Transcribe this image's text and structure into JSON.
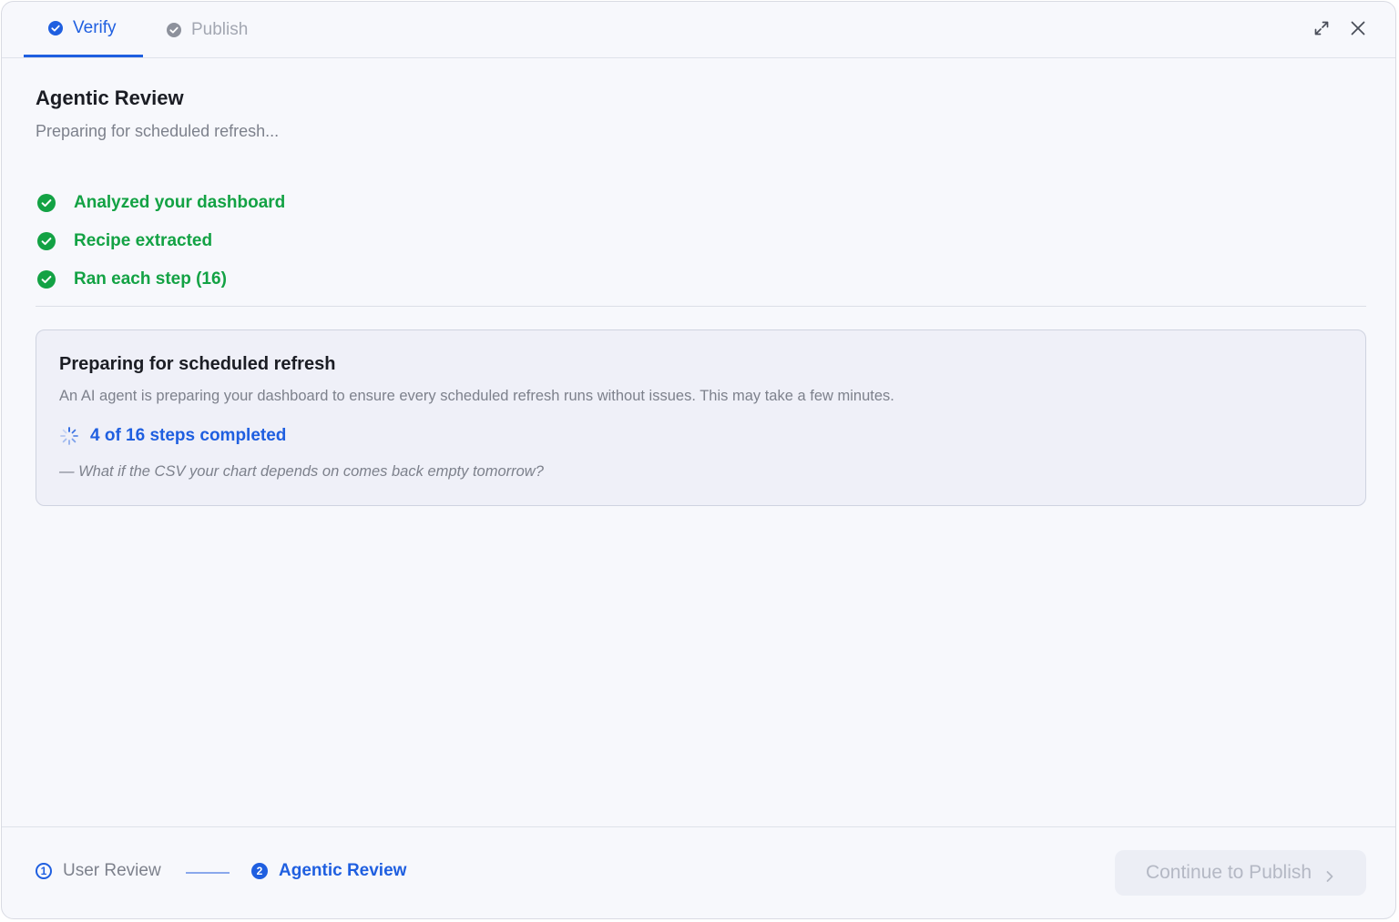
{
  "tabs": [
    {
      "label": "Verify",
      "active": true,
      "icon": "check-circle-icon"
    },
    {
      "label": "Publish",
      "active": false,
      "icon": "check-circle-icon"
    }
  ],
  "header_actions": {
    "expand_icon": "expand-icon",
    "close_icon": "close-icon"
  },
  "main": {
    "title": "Agentic Review",
    "subtitle": "Preparing for scheduled refresh...",
    "steps": [
      {
        "label": "Analyzed your dashboard",
        "status": "done"
      },
      {
        "label": "Recipe extracted",
        "status": "done"
      },
      {
        "label": "Ran each step (16)",
        "status": "done"
      }
    ]
  },
  "card": {
    "title": "Preparing for scheduled refresh",
    "description": "An AI agent is preparing your dashboard to ensure every scheduled refresh runs without issues. This may take a few minutes.",
    "progress_text": "4 of 16 steps completed",
    "quote": "— What if the CSV your chart depends on comes back empty tomorrow?"
  },
  "footer": {
    "steps": [
      {
        "number": "1",
        "label": "User Review",
        "state": "completed"
      },
      {
        "number": "2",
        "label": "Agentic Review",
        "state": "current"
      }
    ],
    "continue_label": "Continue to Publish"
  },
  "colors": {
    "accent": "#1f5fe0",
    "success": "#13a244",
    "muted": "#7d818c",
    "background": "#f7f8fc"
  }
}
